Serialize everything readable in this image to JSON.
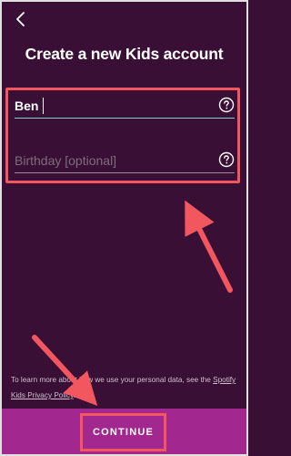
{
  "header": {
    "back_icon": "chevron-left-icon",
    "title": "Create a new Kids account"
  },
  "form": {
    "name_field": {
      "value": "Ben",
      "placeholder": "",
      "help_icon": "question-circle-icon"
    },
    "birthday_field": {
      "value": "",
      "placeholder": "Birthday [optional]",
      "help_icon": "question-circle-icon"
    }
  },
  "footer": {
    "privacy_prefix": "To learn more about how we use your personal data, see the",
    "privacy_link": "Spotify Kids Privacy Policy",
    "privacy_suffix": ".",
    "continue_label": "CONTINUE"
  },
  "colors": {
    "background": "#3a0f36",
    "footer": "#a2288f",
    "highlight": "#f2565e",
    "active_underline": "#7fd0c9"
  }
}
